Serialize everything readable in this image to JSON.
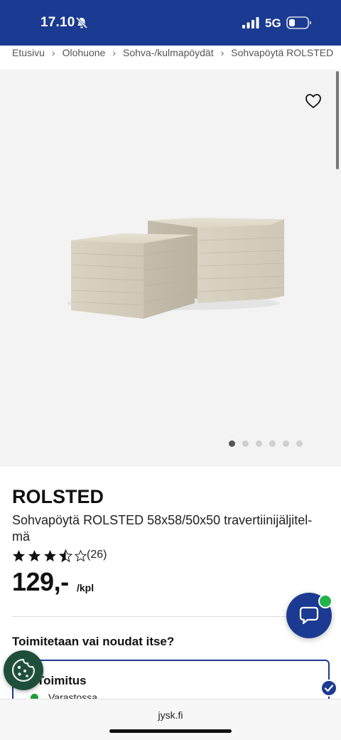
{
  "status_bar": {
    "time": "17.10",
    "network": "5G",
    "background_color": "#1b3a91"
  },
  "breadcrumb": {
    "items": [
      "Etusivu",
      "Olohuone",
      "Sohva-/kulmapöydät",
      "Sohvapöytä ROLSTED"
    ],
    "separator": "›"
  },
  "gallery": {
    "image_count": 6,
    "active_index": 0,
    "favorite_icon": "heart-outline-icon"
  },
  "product": {
    "brand": "ROLSTED",
    "name": "Sohvapöytä ROLSTED 58x58/50x50 travertiinijäljitel-mä",
    "rating": 3.5,
    "rating_max": 5,
    "review_count": "(26)",
    "price": "129,-",
    "price_unit": "/kpl"
  },
  "delivery": {
    "heading": "Toimitetaan vai noudat itse?",
    "option_title": "Toimitus",
    "stock_status": "Varastossa",
    "stock_color": "#1f9d3a",
    "selected": true
  },
  "browser": {
    "url": "jysk.fi"
  },
  "colors": {
    "brand_blue": "#1b3a91",
    "cookie_green": "#1f4f3b",
    "online_green": "#23b24a"
  }
}
